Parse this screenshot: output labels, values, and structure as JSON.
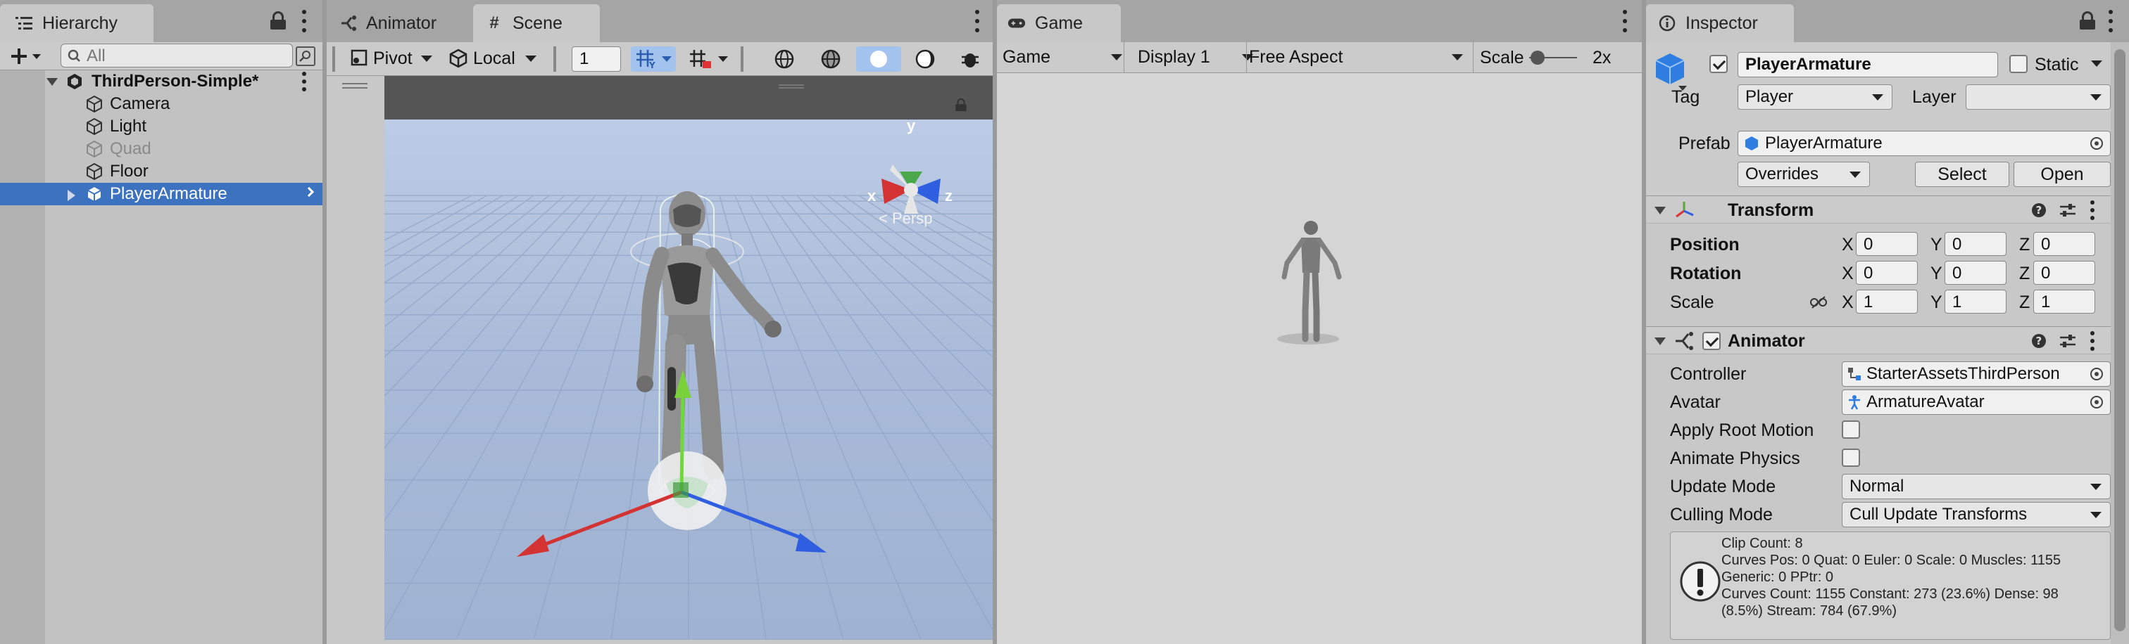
{
  "hierarchy": {
    "tab": "Hierarchy",
    "search_placeholder": "All",
    "scene": "ThirdPerson-Simple*",
    "items": [
      {
        "label": "Camera"
      },
      {
        "label": "Light"
      },
      {
        "label": "Quad",
        "inactive": true
      },
      {
        "label": "Floor"
      },
      {
        "label": "PlayerArmature",
        "selected": true
      }
    ]
  },
  "scene_view": {
    "tabs": [
      "Animator",
      "Scene"
    ],
    "active_tab": "Scene",
    "pivot": "Pivot",
    "space": "Local",
    "grid_value": "1",
    "gizmo_axes": {
      "x": "x",
      "y": "y",
      "z": "z"
    },
    "projection": "< Persp"
  },
  "game_view": {
    "tab": "Game",
    "mode": "Game",
    "display": "Display 1",
    "aspect": "Free Aspect",
    "scale_label": "Scale",
    "scale_value": "2x",
    "scale_level": 0.05
  },
  "inspector": {
    "tab": "Inspector",
    "object_name": "PlayerArmature",
    "active": true,
    "static_label": "Static",
    "static": false,
    "tag_label": "Tag",
    "tag": "Player",
    "layer_label": "Layer",
    "layer": "",
    "prefab_label": "Prefab",
    "prefab": "PlayerArmature",
    "overrides": "Overrides",
    "select": "Select",
    "open": "Open",
    "transform": {
      "title": "Transform",
      "position": {
        "label": "Position",
        "x": "0",
        "y": "0",
        "z": "0"
      },
      "rotation": {
        "label": "Rotation",
        "x": "0",
        "y": "0",
        "z": "0"
      },
      "scale": {
        "label": "Scale",
        "x": "1",
        "y": "1",
        "z": "1"
      }
    },
    "animator": {
      "title": "Animator",
      "enabled": true,
      "controller_label": "Controller",
      "controller": "StarterAssetsThirdPerson",
      "avatar_label": "Avatar",
      "avatar": "ArmatureAvatar",
      "apply_root_motion_label": "Apply Root Motion",
      "animate_physics_label": "Animate Physics",
      "update_mode_label": "Update Mode",
      "update_mode": "Normal",
      "culling_mode_label": "Culling Mode",
      "culling_mode": "Cull Update Transforms",
      "info": [
        "Clip Count: 8",
        "Curves Pos: 0 Quat: 0 Euler: 0 Scale: 0 Muscles: 1155",
        "Generic: 0 PPtr: 0",
        "Curves Count: 1155 Constant: 273 (23.6%) Dense: 98",
        "(8.5%) Stream: 784 (67.9%)"
      ]
    }
  },
  "colors": {
    "selection": "#3d72c0",
    "header": "#a5a5a5",
    "panel": "#c8c8c8",
    "tool_selected": "#a3c3ee",
    "axis_x": "#d33333",
    "axis_y": "#7ad23a",
    "axis_z": "#2f5fe0"
  }
}
